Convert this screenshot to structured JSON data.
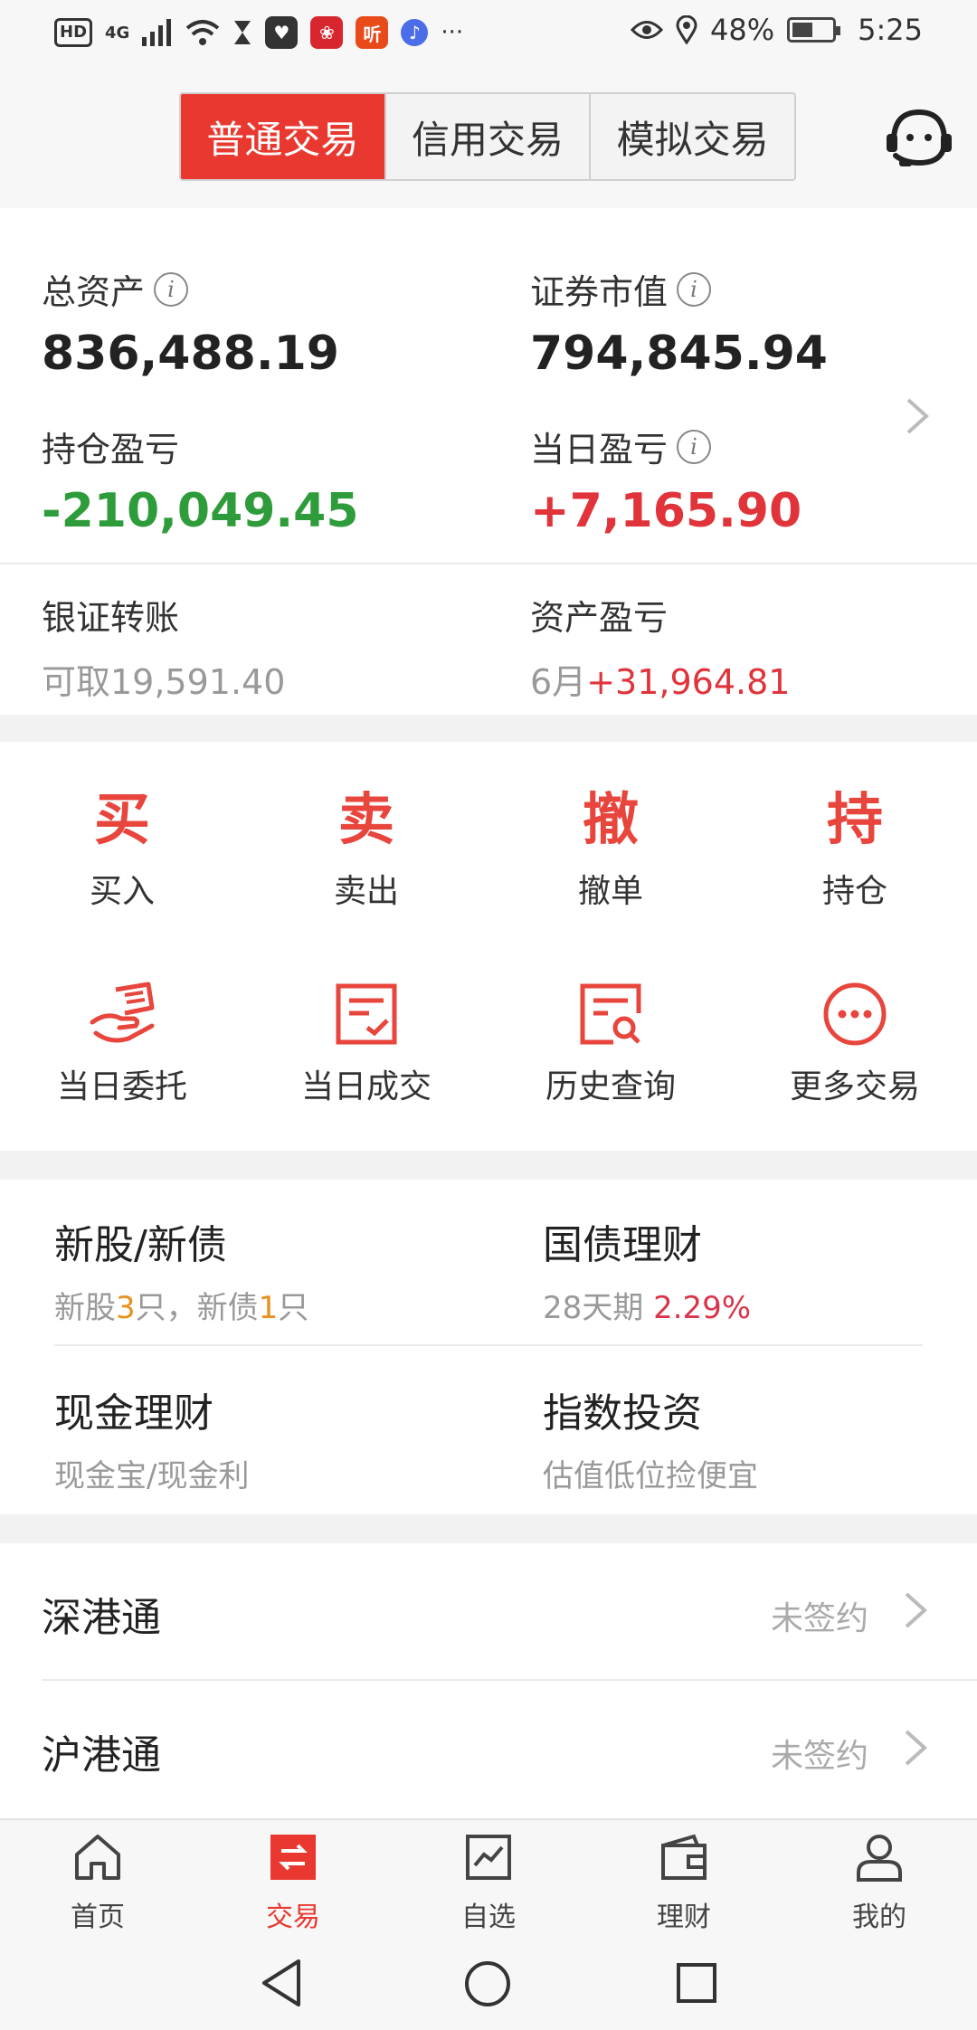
{
  "status_bar": {
    "hd": "HD",
    "network": "4G",
    "battery": "48%",
    "time": "5:25",
    "app_badge": "听",
    "more": "···"
  },
  "header": {
    "tabs": [
      "普通交易",
      "信用交易",
      "模拟交易"
    ],
    "active_tab": 0
  },
  "account": {
    "total_assets_label": "总资产",
    "total_assets": "836,488.19",
    "market_value_label": "证券市值",
    "market_value": "794,845.94",
    "position_pl_label": "持仓盈亏",
    "position_pl": "-210,049.45",
    "daily_pl_label": "当日盈亏",
    "daily_pl": "+7,165.90",
    "transfer_label": "银证转账",
    "transfer_sub": "可取19,591.40",
    "asset_pl_label": "资产盈亏",
    "asset_pl_month": "6月",
    "asset_pl_value": "+31,964.81"
  },
  "actions": {
    "buy": {
      "char": "买",
      "label": "买入"
    },
    "sell": {
      "char": "卖",
      "label": "卖出"
    },
    "cancel": {
      "char": "撤",
      "label": "撤单"
    },
    "hold": {
      "char": "持",
      "label": "持仓"
    },
    "today_orders": {
      "label": "当日委托"
    },
    "today_deals": {
      "label": "当日成交"
    },
    "history": {
      "label": "历史查询"
    },
    "more": {
      "label": "更多交易"
    }
  },
  "products": {
    "ipo": {
      "title": "新股/新债",
      "sub_a": "新股",
      "sub_a_count": "3",
      "sub_b": "只，新债",
      "sub_b_count": "1",
      "sub_c": "只"
    },
    "treasury": {
      "title": "国债理财",
      "sub": "28天期",
      "rate": "2.29%"
    },
    "cash": {
      "title": "现金理财",
      "sub": "现金宝/现金利"
    },
    "index": {
      "title": "指数投资",
      "sub": "估值低位捡便宜"
    }
  },
  "hk_connect": [
    {
      "title": "深港通",
      "status": "未签约"
    },
    {
      "title": "沪港通",
      "status": "未签约"
    }
  ],
  "tabbar": {
    "items": [
      "首页",
      "交易",
      "自选",
      "理财",
      "我的"
    ],
    "active": 1
  },
  "colors": {
    "accent": "#e8382f",
    "loss_green": "#2e9c3a",
    "gain_red": "#e0333a",
    "orange": "#e8901e"
  }
}
